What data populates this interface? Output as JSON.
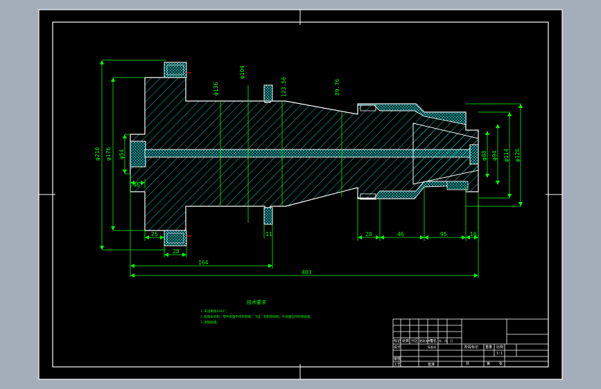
{
  "colors": {
    "background": "#a4aebb",
    "paper": "#000000",
    "frame": "#ffffff",
    "outline": "#ffffff",
    "hatch": "#00ffff",
    "dimension": "#00ff00",
    "title_block": "#ffffff",
    "red_marker": "#ff0000"
  },
  "dimensions": {
    "dia_210": "φ210",
    "dia_176": "φ176",
    "dia_54": "φ54",
    "len_46": "46",
    "len_25": "25",
    "len_28_left": "28",
    "len_164": "164",
    "len_403": "403",
    "dia_104": "φ104",
    "dia_136": "φ136",
    "len_11": "11",
    "dia_123_56": "123.56",
    "dia_89_76": "89.76",
    "len_28_right": "28",
    "len_46_right": "46",
    "len_95": "95",
    "len_16": "16",
    "dia_88": "φ88",
    "dia_94": "φ94",
    "dia_114": "φ114",
    "dia_126": "φ126"
  },
  "notes": {
    "title": "技术要求",
    "line1": "1.未注倒角1X45°。",
    "line2": "2.锐角去毛刺，零件表面不得有划痕、飞边、毛刺等缺陷，外表面应作防锈处理。",
    "line3": "3.调质处理。"
  },
  "title_block": {
    "row_labels": [
      "标记",
      "处数",
      "分区",
      "更改文件号",
      "签名",
      "年、月、日"
    ],
    "design": "设计",
    "standardize": "标准化",
    "review": "审核",
    "process": "工艺",
    "approve": "批准",
    "stage_mark": "阶段标记",
    "weight": "重量",
    "scale": "比例",
    "scale_value": "1:1",
    "sheet_total": "共",
    "sheet_no": "第",
    "sheets": "张"
  }
}
